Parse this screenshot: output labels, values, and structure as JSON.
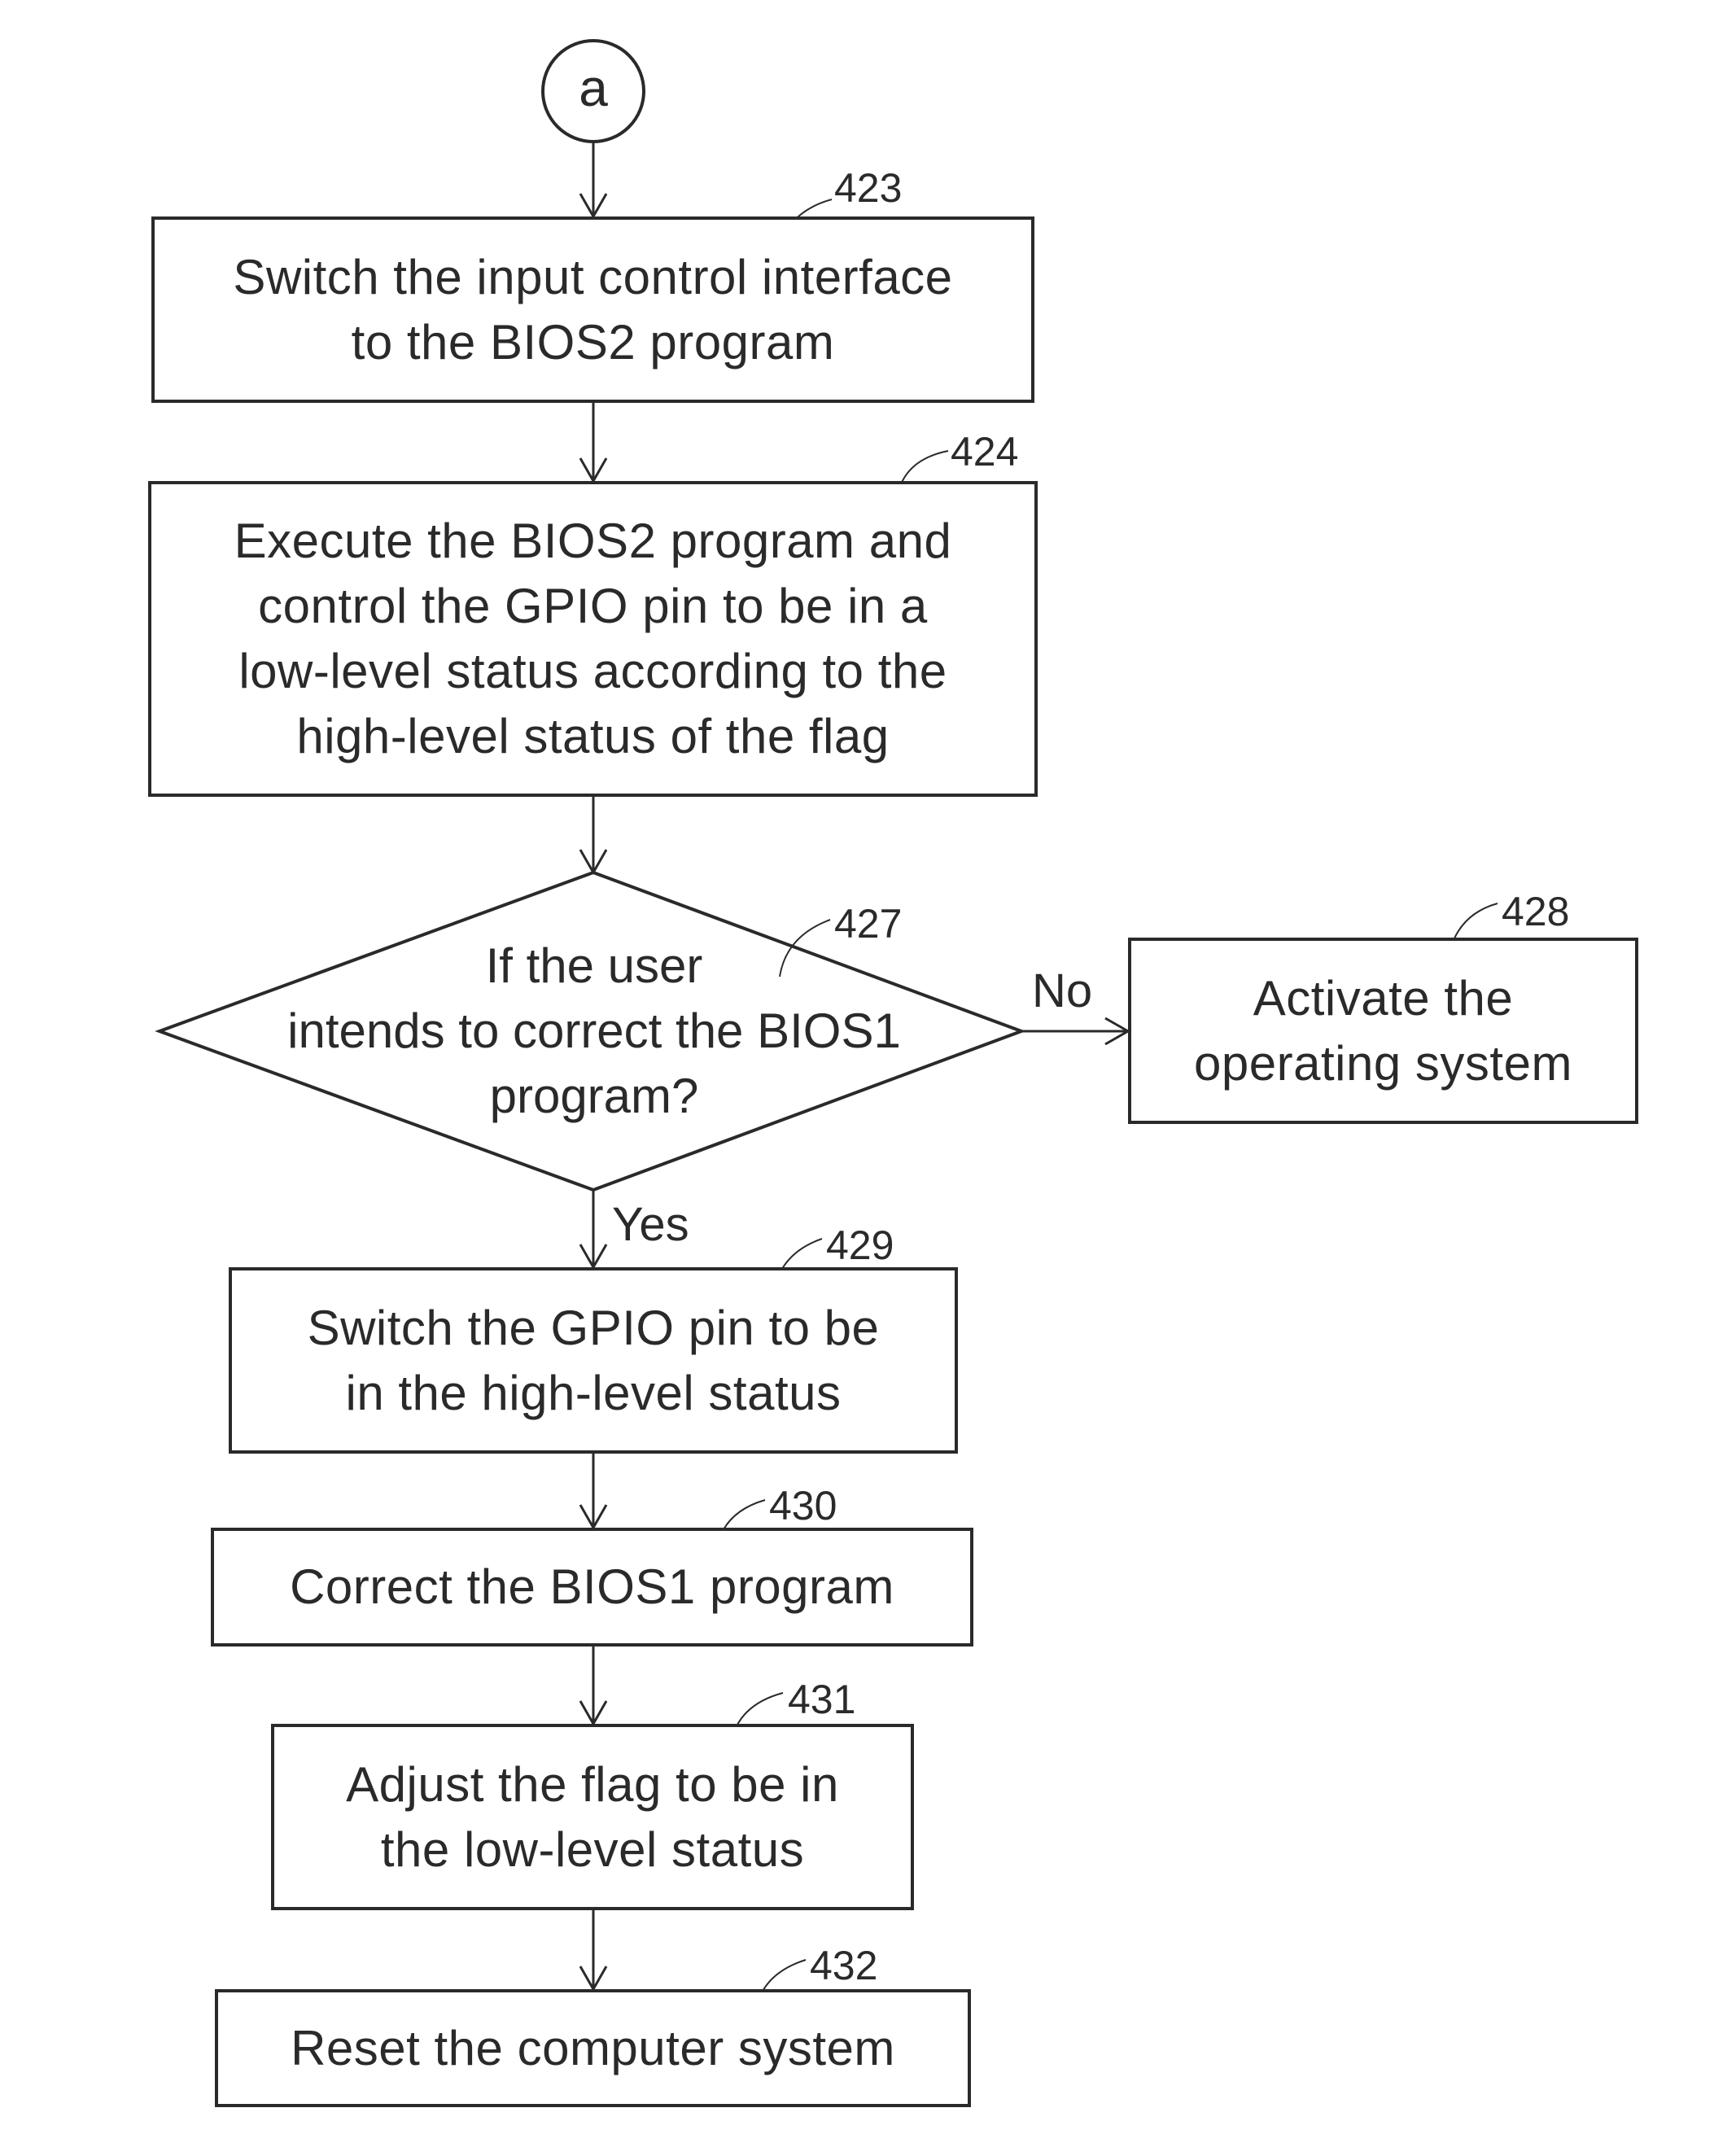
{
  "connector": {
    "label": "a"
  },
  "steps": [
    {
      "id": "423",
      "text": [
        "Switch the input control interface",
        "to the BIOS2 program"
      ]
    },
    {
      "id": "424",
      "text": [
        "Execute the BIOS2 program and",
        "control the GPIO pin to be in a",
        "low-level status according to the",
        "high-level status of the flag"
      ]
    },
    {
      "id": "427",
      "text": [
        "If the user",
        "intends to correct the BIOS1",
        "program?"
      ]
    },
    {
      "id": "428",
      "text": [
        "Activate the",
        "operating system"
      ]
    },
    {
      "id": "429",
      "text": [
        "Switch the GPIO pin to be",
        "in the high-level status"
      ]
    },
    {
      "id": "430",
      "text": [
        "Correct the BIOS1 program"
      ]
    },
    {
      "id": "431",
      "text": [
        "Adjust the flag to be in",
        "the low-level status"
      ]
    },
    {
      "id": "432",
      "text": [
        "Reset the computer system"
      ]
    }
  ],
  "branches": {
    "no": "No",
    "yes": "Yes"
  },
  "colors": {
    "line": "#2a2a2a",
    "background": "#ffffff"
  }
}
